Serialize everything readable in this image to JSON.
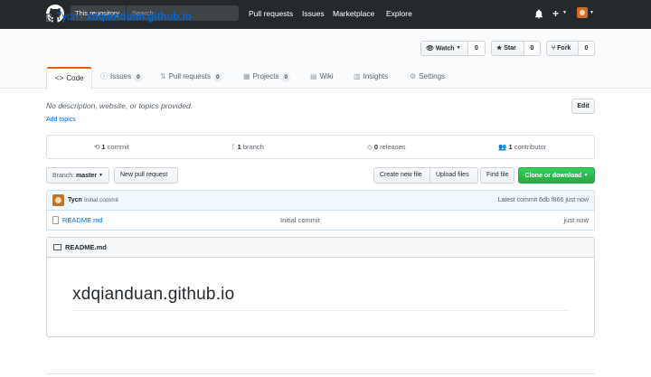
{
  "header": {
    "search_scope": "This repository",
    "search_placeholder": "Search",
    "nav": [
      "Pull requests",
      "Issues",
      "Marketplace",
      "Explore"
    ],
    "plus_label": "+"
  },
  "repo": {
    "owner": "Tycn",
    "separator": "/",
    "name": "xdqianduan.github.io",
    "watch_label": "Watch",
    "watch_count": "0",
    "star_label": "Star",
    "star_count": "0",
    "fork_label": "Fork",
    "fork_count": "0"
  },
  "tabs": [
    {
      "label": "Code",
      "icon": "code-icon"
    },
    {
      "label": "Issues",
      "count": "0",
      "icon": "issue-icon"
    },
    {
      "label": "Pull requests",
      "count": "0",
      "icon": "pr-icon"
    },
    {
      "label": "Projects",
      "count": "0",
      "icon": "project-icon"
    },
    {
      "label": "Wiki",
      "icon": "wiki-icon"
    },
    {
      "label": "Insights",
      "icon": "graph-icon"
    },
    {
      "label": "Settings",
      "icon": "gear-icon"
    }
  ],
  "description": "No description, website, or topics provided.",
  "add_topics": "Add topics",
  "edit_label": "Edit",
  "summary": {
    "commits_num": "1",
    "commits_label": "commit",
    "branches_num": "1",
    "branches_label": "branch",
    "releases_num": "0",
    "releases_label": "releases",
    "contributors_num": "1",
    "contributors_label": "contributor"
  },
  "filebar": {
    "branch_label": "Branch:",
    "branch_value": "master",
    "new_pr": "New pull request",
    "create_file": "Create new file",
    "upload_files": "Upload files",
    "find_file": "Find file",
    "clone": "Clone or download"
  },
  "latest_commit": {
    "author": "Tycn",
    "message": "Initial commit",
    "prefix": "Latest commit",
    "sha": "6db f866",
    "age": "just now"
  },
  "files": [
    {
      "name": "README.md",
      "message": "Initial commit",
      "age": "just now"
    }
  ],
  "readme": {
    "label": "README.md",
    "heading": "xdqianduan.github.io"
  },
  "colors": {
    "header_bg": "#24292e",
    "link": "#0366d6",
    "tab_accent": "#e36209",
    "clone_green": "#28a745"
  }
}
